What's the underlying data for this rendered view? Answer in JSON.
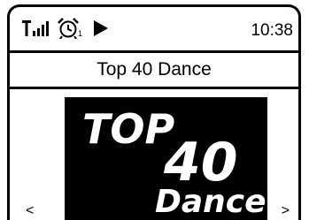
{
  "status": {
    "time": "10:38",
    "alarm_number": "1",
    "icons": [
      "signal-icon",
      "alarm-clock-icon",
      "play-icon"
    ]
  },
  "station": {
    "name": "Top 40 Dance"
  },
  "logo": {
    "line1": "TOP",
    "number": "40",
    "line2": "Dance"
  },
  "nav": {
    "prev": "<",
    "next": ">"
  }
}
